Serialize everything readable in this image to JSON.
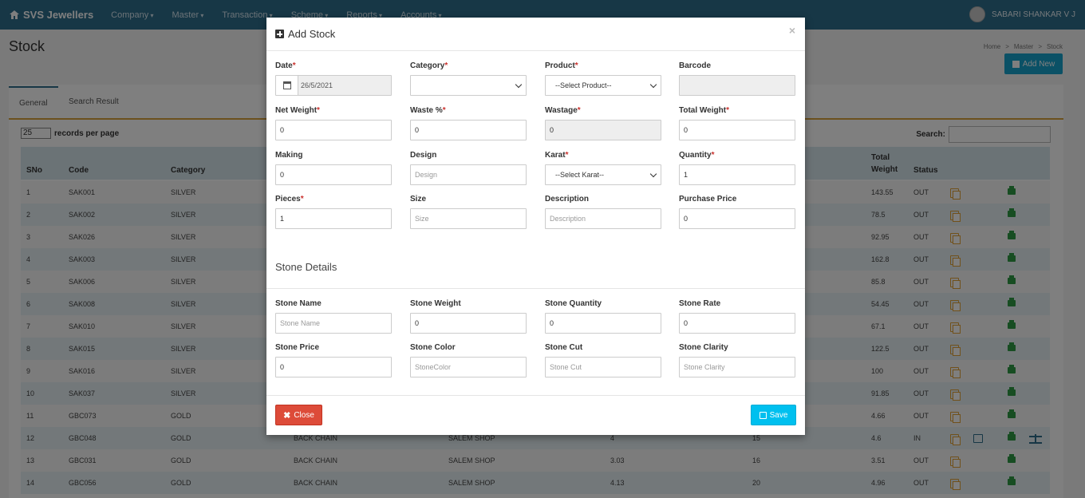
{
  "navbar": {
    "brand": "SVS Jewellers",
    "menu": [
      "Company",
      "Master",
      "Transaction",
      "Scheme",
      "Reports",
      "Accounts"
    ],
    "user": "SABARI SHANKAR V J"
  },
  "page": {
    "title": "Stock",
    "breadcrumb": [
      "Home",
      ">",
      "Master",
      ">",
      "Stock"
    ],
    "add_new": "Add New",
    "tabs": [
      "General",
      "Search Result"
    ],
    "records_value": "25",
    "records_label": "records per page",
    "search_label": "Search:",
    "columns": {
      "sno": "SNo",
      "code": "Code",
      "category": "Category",
      "total_weight_1": "Total",
      "total_weight_2": "Weight",
      "status": "Status"
    },
    "rows": [
      {
        "sno": "1",
        "code": "SAK001",
        "category": "SILVER",
        "c4": "",
        "c5": "",
        "c6": "",
        "c7": "",
        "total": "143.55",
        "status": "OUT"
      },
      {
        "sno": "2",
        "code": "SAK002",
        "category": "SILVER",
        "c4": "",
        "c5": "",
        "c6": "",
        "c7": "",
        "total": "78.5",
        "status": "OUT"
      },
      {
        "sno": "3",
        "code": "SAK026",
        "category": "SILVER",
        "c4": "",
        "c5": "",
        "c6": "",
        "c7": "",
        "total": "92.95",
        "status": "OUT"
      },
      {
        "sno": "4",
        "code": "SAK003",
        "category": "SILVER",
        "c4": "",
        "c5": "",
        "c6": "",
        "c7": "",
        "total": "162.8",
        "status": "OUT"
      },
      {
        "sno": "5",
        "code": "SAK006",
        "category": "SILVER",
        "c4": "",
        "c5": "",
        "c6": "",
        "c7": "",
        "total": "85.8",
        "status": "OUT"
      },
      {
        "sno": "6",
        "code": "SAK008",
        "category": "SILVER",
        "c4": "",
        "c5": "",
        "c6": "",
        "c7": "",
        "total": "54.45",
        "status": "OUT"
      },
      {
        "sno": "7",
        "code": "SAK010",
        "category": "SILVER",
        "c4": "",
        "c5": "",
        "c6": "",
        "c7": "",
        "total": "67.1",
        "status": "OUT"
      },
      {
        "sno": "8",
        "code": "SAK015",
        "category": "SILVER",
        "c4": "",
        "c5": "",
        "c6": "",
        "c7": "",
        "total": "122.5",
        "status": "OUT"
      },
      {
        "sno": "9",
        "code": "SAK016",
        "category": "SILVER",
        "c4": "",
        "c5": "",
        "c6": "",
        "c7": "",
        "total": "100",
        "status": "OUT"
      },
      {
        "sno": "10",
        "code": "SAK037",
        "category": "SILVER",
        "c4": "",
        "c5": "",
        "c6": "",
        "c7": "",
        "total": "91.85",
        "status": "OUT"
      },
      {
        "sno": "11",
        "code": "GBC073",
        "category": "GOLD",
        "c4": "",
        "c5": "",
        "c6": "",
        "c7": "",
        "total": "4.66",
        "status": "OUT"
      },
      {
        "sno": "12",
        "code": "GBC048",
        "category": "GOLD",
        "c4": "BACK CHAIN",
        "c5": "SALEM SHOP",
        "c6": "4",
        "c7": "15",
        "total": "4.6",
        "status": "IN"
      },
      {
        "sno": "13",
        "code": "GBC031",
        "category": "GOLD",
        "c4": "BACK CHAIN",
        "c5": "SALEM SHOP",
        "c6": "3.03",
        "c7": "16",
        "total": "3.51",
        "status": "OUT"
      },
      {
        "sno": "14",
        "code": "GBC056",
        "category": "GOLD",
        "c4": "BACK CHAIN",
        "c5": "SALEM SHOP",
        "c6": "4.13",
        "c7": "20",
        "total": "4.96",
        "status": "OUT"
      }
    ]
  },
  "modal": {
    "title": "Add Stock",
    "close_symbol": "×",
    "req_mark": "*",
    "fields": {
      "date": {
        "label": "Date",
        "value": "26/5/2021"
      },
      "category": {
        "label": "Category",
        "value": ""
      },
      "product": {
        "label": "Product",
        "value": "--Select Product--"
      },
      "barcode": {
        "label": "Barcode",
        "value": ""
      },
      "net_weight": {
        "label": "Net Weight",
        "value": "0"
      },
      "waste": {
        "label": "Waste %",
        "value": "0"
      },
      "wastage": {
        "label": "Wastage",
        "value": "0"
      },
      "total_weight": {
        "label": "Total Weight",
        "value": "0"
      },
      "making": {
        "label": "Making",
        "value": "0"
      },
      "design": {
        "label": "Design",
        "placeholder": "Design"
      },
      "karat": {
        "label": "Karat",
        "value": "--Select Karat--"
      },
      "quantity": {
        "label": "Quantity",
        "value": "1"
      },
      "pieces": {
        "label": "Pieces",
        "value": "1"
      },
      "size": {
        "label": "Size",
        "placeholder": "Size"
      },
      "description": {
        "label": "Description",
        "placeholder": "Description"
      },
      "purchase_price": {
        "label": "Purchase Price",
        "value": "0"
      }
    },
    "stone_section_title": "Stone Details",
    "stone_fields": {
      "name": {
        "label": "Stone Name",
        "placeholder": "Stone Name"
      },
      "weight": {
        "label": "Stone Weight",
        "value": "0"
      },
      "quantity": {
        "label": "Stone Quantity",
        "value": "0"
      },
      "rate": {
        "label": "Stone Rate",
        "value": "0"
      },
      "price": {
        "label": "Stone Price",
        "value": "0"
      },
      "color": {
        "label": "Stone Color",
        "placeholder": "StoneColor"
      },
      "cut": {
        "label": "Stone Cut",
        "placeholder": "Stone Cut"
      },
      "clarity": {
        "label": "Stone Clarity",
        "placeholder": "Stone Clarity"
      }
    },
    "buttons": {
      "close": "Close",
      "save": "Save"
    }
  }
}
